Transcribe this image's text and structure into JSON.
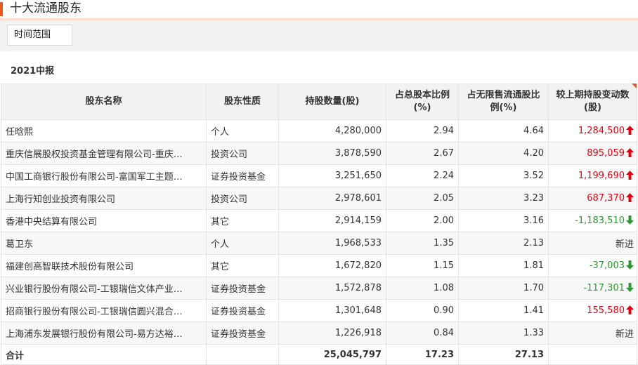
{
  "header": {
    "title": "十大流通股东"
  },
  "filter": {
    "label": "时间范围"
  },
  "period": "2021中报",
  "table": {
    "columns": [
      "股东名称",
      "股东性质",
      "持股数量(股)",
      "占总股本比例(%)",
      "占无限售流通股比例(%)",
      "较上期持股变动数(股)"
    ],
    "rows": [
      {
        "name": "任晗熙",
        "type": "个人",
        "shares": "4,280,000",
        "pct_total": "2.94",
        "pct_float": "4.64",
        "change": "1,284,500",
        "dir": "up"
      },
      {
        "name": "重庆信展股权投资基金管理有限公司-重庆…",
        "type": "投资公司",
        "shares": "3,878,590",
        "pct_total": "2.67",
        "pct_float": "4.20",
        "change": "895,059",
        "dir": "up"
      },
      {
        "name": "中国工商银行股份有限公司-富国军工主题…",
        "type": "证券投资基金",
        "shares": "3,251,650",
        "pct_total": "2.24",
        "pct_float": "3.52",
        "change": "1,199,690",
        "dir": "up"
      },
      {
        "name": "上海行知创业投资有限公司",
        "type": "投资公司",
        "shares": "2,978,601",
        "pct_total": "2.05",
        "pct_float": "3.23",
        "change": "687,370",
        "dir": "up"
      },
      {
        "name": "香港中央结算有限公司",
        "type": "其它",
        "shares": "2,914,159",
        "pct_total": "2.00",
        "pct_float": "3.16",
        "change": "-1,183,510",
        "dir": "down"
      },
      {
        "name": "葛卫东",
        "type": "个人",
        "shares": "1,968,533",
        "pct_total": "1.35",
        "pct_float": "2.13",
        "change": "新进",
        "dir": "new"
      },
      {
        "name": "福建创高智联技术股份有限公司",
        "type": "其它",
        "shares": "1,672,820",
        "pct_total": "1.15",
        "pct_float": "1.81",
        "change": "-37,003",
        "dir": "down"
      },
      {
        "name": "兴业银行股份有限公司-工银瑞信文体产业…",
        "type": "证券投资基金",
        "shares": "1,572,878",
        "pct_total": "1.08",
        "pct_float": "1.70",
        "change": "-117,301",
        "dir": "down"
      },
      {
        "name": "招商银行股份有限公司-工银瑞信圆兴混合…",
        "type": "证券投资基金",
        "shares": "1,301,648",
        "pct_total": "0.90",
        "pct_float": "1.41",
        "change": "155,580",
        "dir": "up"
      },
      {
        "name": "上海浦东发展银行股份有限公司-易方达裕…",
        "type": "证券投资基金",
        "shares": "1,226,918",
        "pct_total": "0.84",
        "pct_float": "1.33",
        "change": "新进",
        "dir": "new"
      }
    ],
    "total": {
      "label": "合计",
      "shares": "25,045,797",
      "pct_total": "17.23",
      "pct_float": "27.13"
    }
  },
  "colors": {
    "accent": "#e8571d",
    "up": "#e60012",
    "down": "#2b9930",
    "header_bg": "#f2f2f2"
  }
}
